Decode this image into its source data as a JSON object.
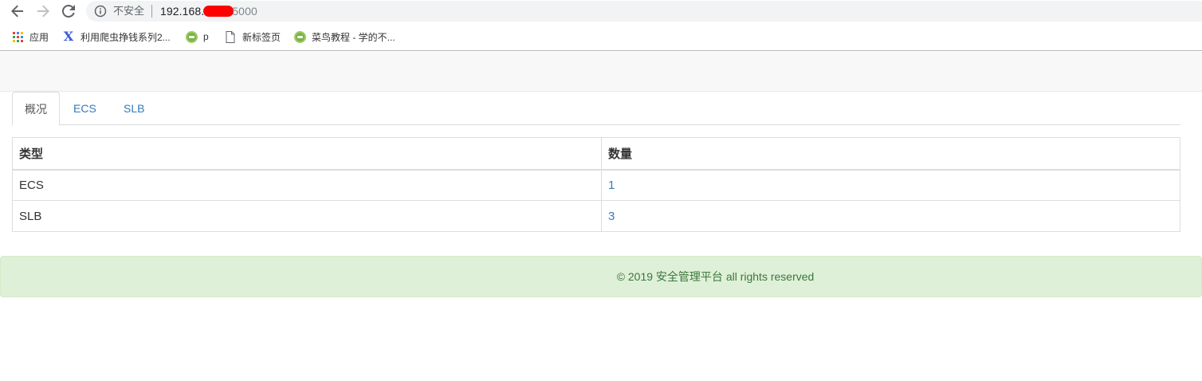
{
  "browser": {
    "address": {
      "insecure_label": "不安全",
      "url_prefix": "192.168.",
      "url_suffix": "5000"
    }
  },
  "bookmarks": [
    {
      "label": "应用",
      "icon": "apps-icon"
    },
    {
      "label": "利用爬虫挣钱系列2...",
      "icon": "x-logo-icon"
    },
    {
      "label": "p",
      "icon": "runoob-icon"
    },
    {
      "label": "新标签页",
      "icon": "page-icon"
    },
    {
      "label": "菜鸟教程 - 学的不...",
      "icon": "runoob-icon"
    }
  ],
  "tabs": [
    {
      "label": "概况",
      "active": true
    },
    {
      "label": "ECS",
      "active": false
    },
    {
      "label": "SLB",
      "active": false
    }
  ],
  "table": {
    "headers": [
      "类型",
      "数量"
    ],
    "rows": [
      [
        "ECS",
        "1"
      ],
      [
        "SLB",
        "3"
      ]
    ]
  },
  "footer": {
    "text": "© 2019 安全管理平台 all rights reserved"
  },
  "colors": {
    "link": "#337ab7",
    "footer_bg": "#dff0d8",
    "footer_text": "#3c763d",
    "navbar_bg": "#f8f8f8"
  }
}
